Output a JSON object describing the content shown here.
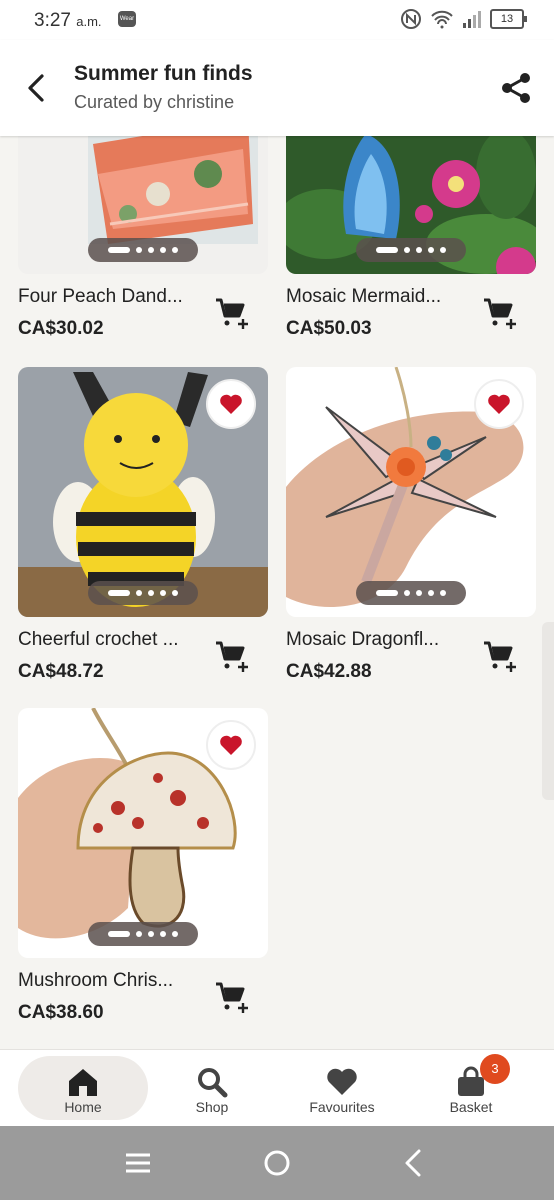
{
  "status": {
    "time": "3:27",
    "ampm": "a.m.",
    "wear": "Wear",
    "battery": "13"
  },
  "header": {
    "title": "Summer fun finds",
    "subtitle": "Curated by christine"
  },
  "items": [
    {
      "name": "Four Peach Dand...",
      "price": "CA$30.02",
      "favorited": false
    },
    {
      "name": "Mosaic Mermaid...",
      "price": "CA$50.03",
      "favorited": false
    },
    {
      "name": "Cheerful crochet ...",
      "price": "CA$48.72",
      "favorited": true
    },
    {
      "name": "Mosaic Dragonfl...",
      "price": "CA$42.88",
      "favorited": true
    },
    {
      "name": "Mushroom Chris...",
      "price": "CA$38.60",
      "favorited": true
    }
  ],
  "nav": {
    "home": "Home",
    "shop": "Shop",
    "favourites": "Favourites",
    "basket": "Basket",
    "basket_count": "3"
  },
  "colors": {
    "favorite": "#c9152b",
    "badge": "#e04a1f"
  }
}
